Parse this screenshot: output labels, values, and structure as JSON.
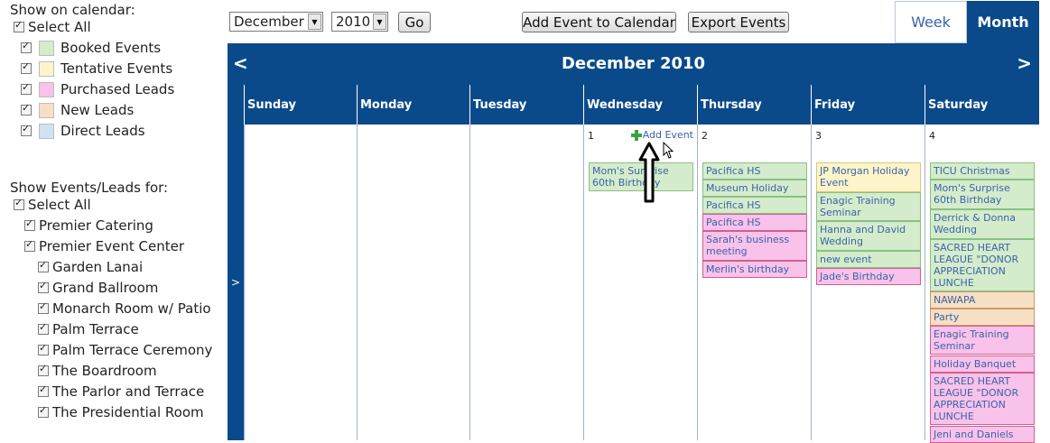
{
  "left": {
    "show_on_calendar_title": "Show on calendar:",
    "select_all_label": "Select All",
    "legend": [
      {
        "label": "Booked Events",
        "color": "#d4eccb"
      },
      {
        "label": "Tentative Events",
        "color": "#fdf5c9"
      },
      {
        "label": "Purchased Leads",
        "color": "#f8c2ea"
      },
      {
        "label": "New Leads",
        "color": "#f7dfc4"
      },
      {
        "label": "Direct Leads",
        "color": "#cfe2f1"
      }
    ],
    "show_for_title": "Show Events/Leads for:",
    "select_all_2_label": "Select All",
    "venues": [
      "Premier Catering",
      "Premier Event Center"
    ],
    "rooms": [
      "Garden Lanai",
      "Grand Ballroom",
      "Monarch Room w/ Patio",
      "Palm Terrace",
      "Palm Terrace Ceremony",
      "The Boardroom",
      "The Parlor and Terrace",
      "The Presidential Room"
    ]
  },
  "toolbar": {
    "month_value": "December",
    "year_value": "2010",
    "go_label": "Go",
    "add_event_label": "Add Event to Calendar",
    "export_label": "Export Events",
    "week_tab": "Week",
    "month_tab": "Month"
  },
  "calendar": {
    "title": "December 2010",
    "prev": "<",
    "next": ">",
    "week_marker": ">",
    "days": [
      "Sunday",
      "Monday",
      "Tuesday",
      "Wednesday",
      "Thursday",
      "Friday",
      "Saturday"
    ],
    "add_event_link": "Add Event",
    "cells": [
      {
        "day": "",
        "events": []
      },
      {
        "day": "",
        "events": []
      },
      {
        "day": "",
        "events": []
      },
      {
        "day": "1",
        "events": [
          {
            "text": "Mom's Surprise 60th Birthday",
            "type": "booked"
          }
        ]
      },
      {
        "day": "2",
        "events": [
          {
            "text": "Pacifica HS Volleyball",
            "type": "booked"
          },
          {
            "text": "Museum Holiday Party",
            "type": "booked"
          },
          {
            "text": "Pacifica HS Volleyball",
            "type": "booked"
          },
          {
            "text": "Pacifica HS Volleyball",
            "type": "purchased"
          },
          {
            "text": "Sarah's business meeting",
            "type": "purchased"
          },
          {
            "text": "Merlin's birthday party",
            "type": "purchased"
          }
        ]
      },
      {
        "day": "3",
        "events": [
          {
            "text": "JP Morgan Holiday Event",
            "type": "tentative"
          },
          {
            "text": "Enagic Training Seminar",
            "type": "booked"
          },
          {
            "text": "Hanna and David Wedding",
            "type": "booked"
          },
          {
            "text": "new event",
            "type": "booked"
          },
          {
            "text": "Jade's Birthday",
            "type": "purchased"
          }
        ]
      },
      {
        "day": "4",
        "events": [
          {
            "text": "TICU Christmas Party",
            "type": "booked"
          },
          {
            "text": "Mom's Surprise 60th Birthday",
            "type": "booked"
          },
          {
            "text": "Derrick & Donna Wedding",
            "type": "booked"
          },
          {
            "text": "SACRED HEART LEAGUE \"DONOR APPRECIATION LUNCHE",
            "type": "booked"
          },
          {
            "text": "NAWAPA",
            "type": "newlead"
          },
          {
            "text": "Party",
            "type": "newlead"
          },
          {
            "text": "Enagic Training Seminar",
            "type": "purchased"
          },
          {
            "text": "Holiday Banquet",
            "type": "purchased"
          },
          {
            "text": "SACRED HEART LEAGUE \"DONOR APPRECIATION LUNCHE",
            "type": "purchased"
          },
          {
            "text": "Jeni and Daniels",
            "type": "purchased"
          }
        ]
      }
    ]
  },
  "icons": {
    "add_event_icon": "green-plus-icon",
    "annotation": "up-arrow-annotation-icon"
  }
}
